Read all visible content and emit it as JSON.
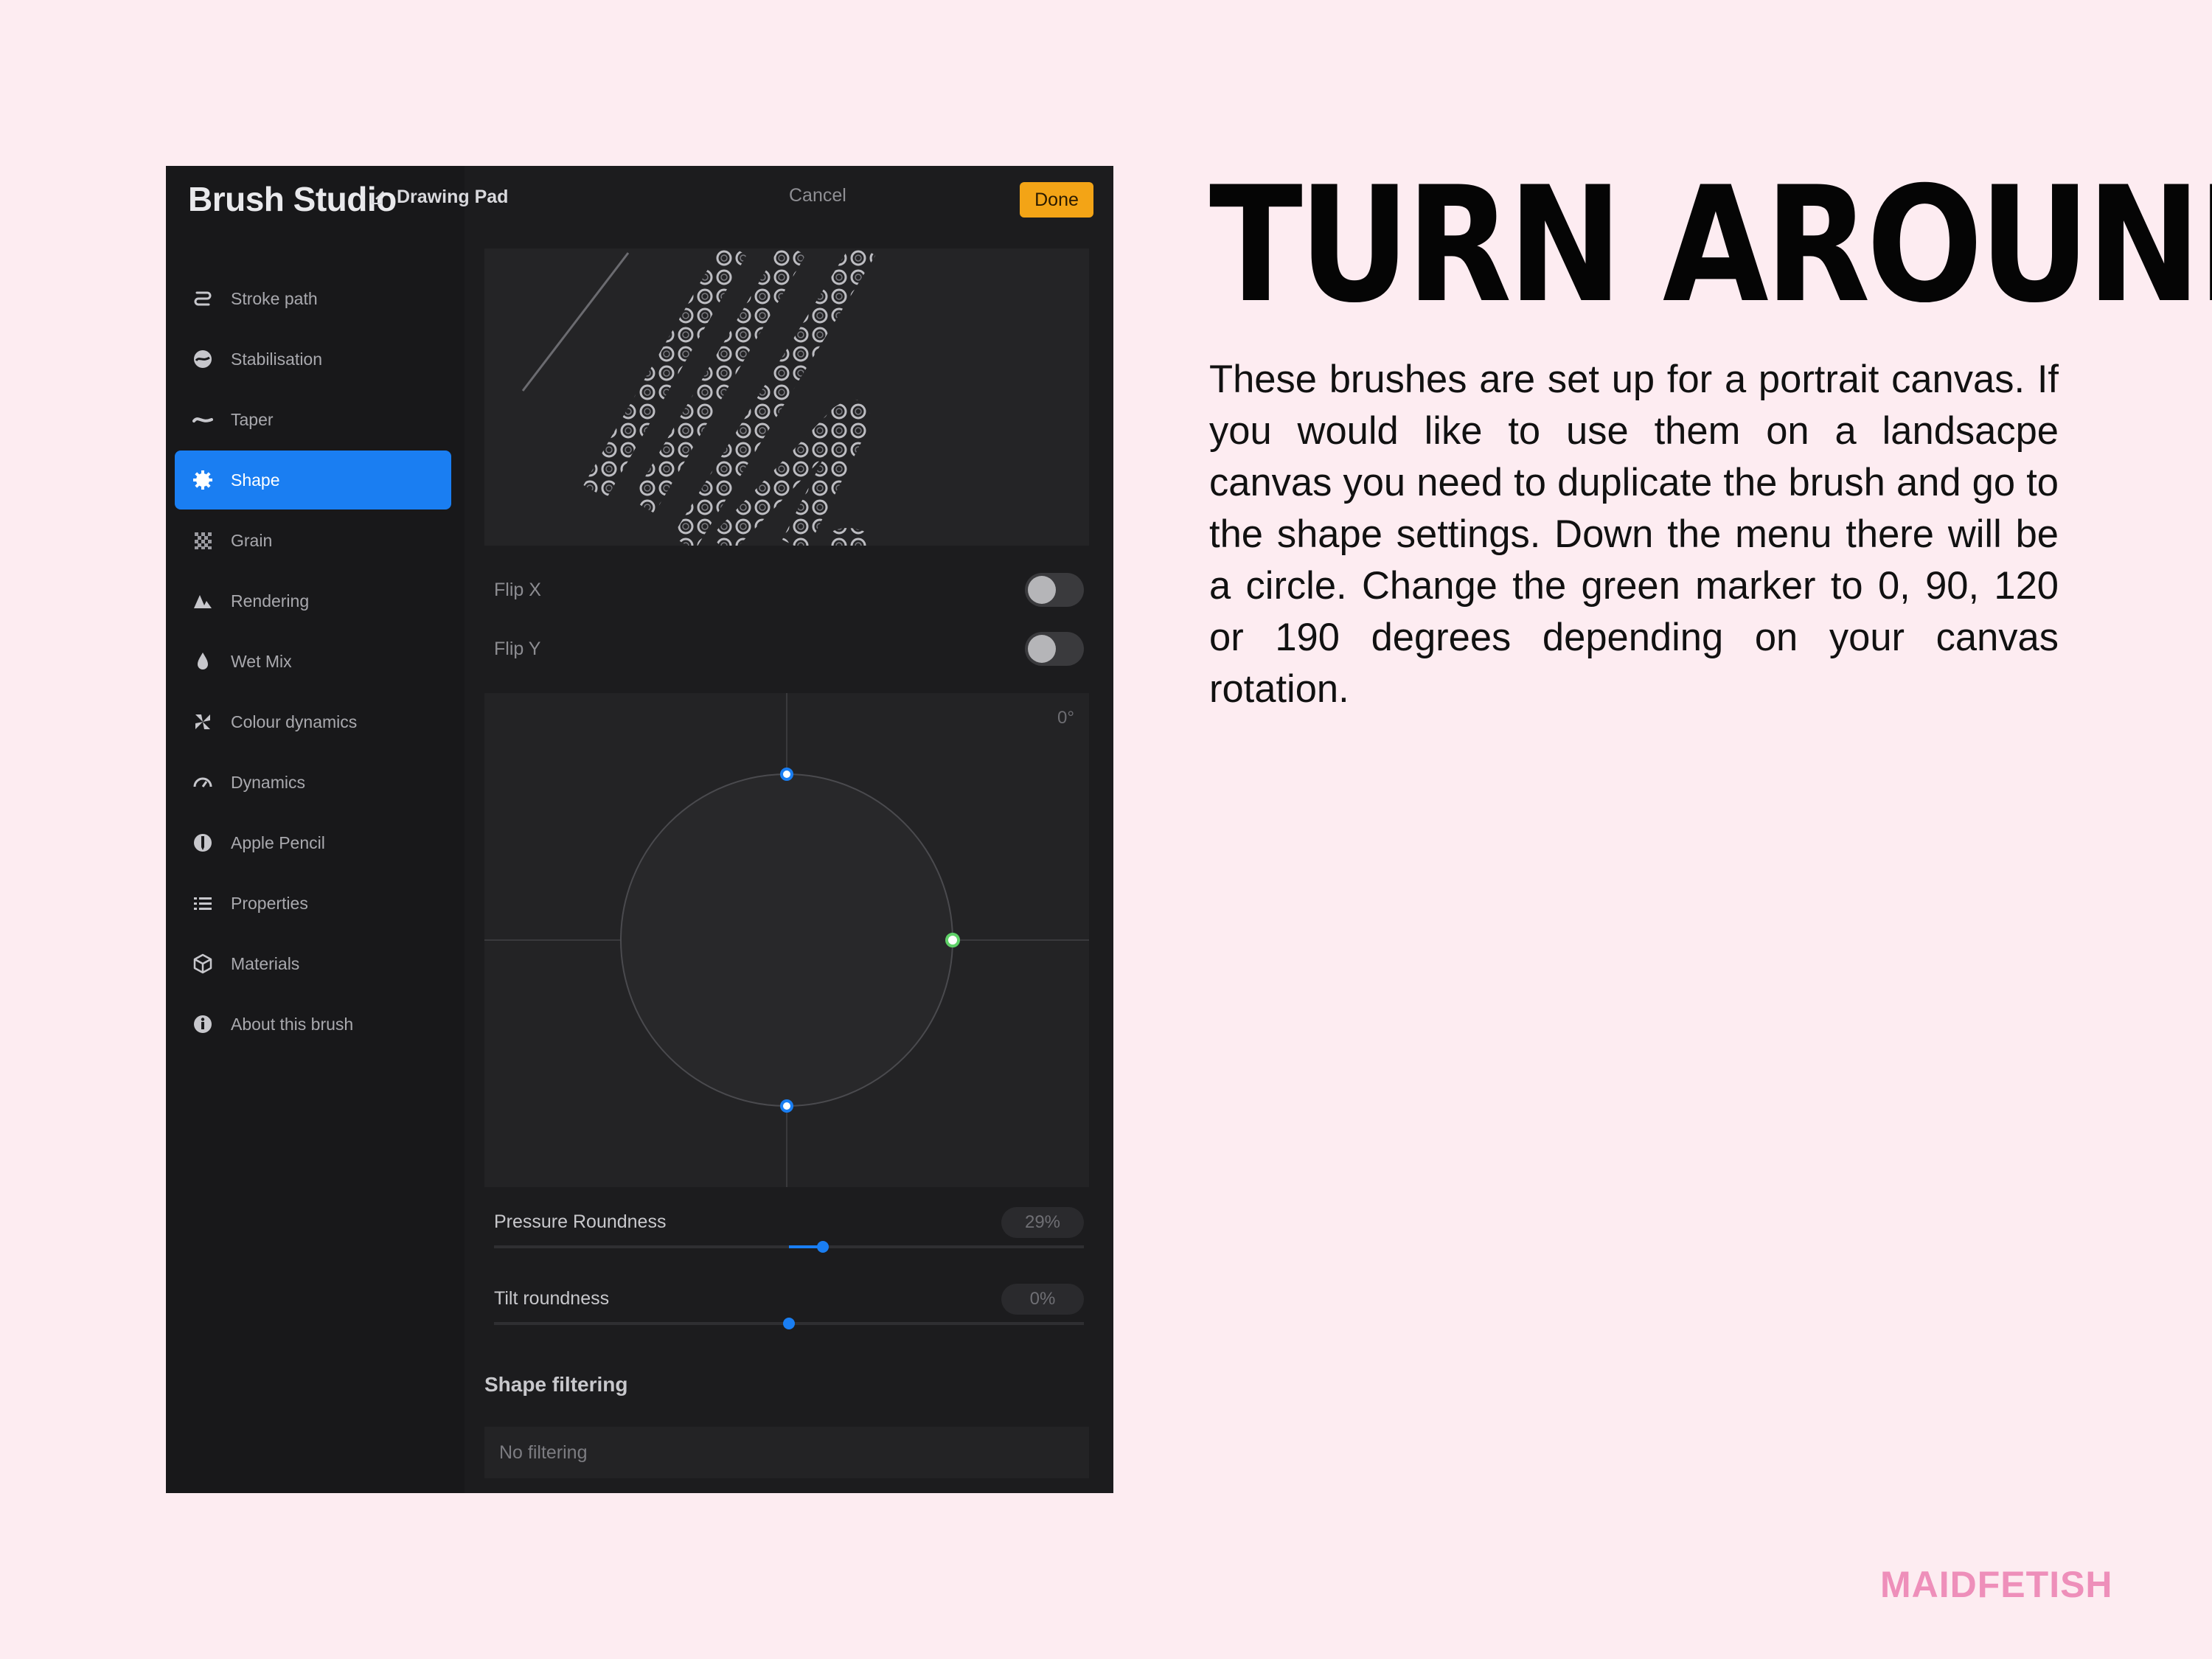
{
  "app": {
    "title": "Brush Studio",
    "drawing_pad_label": "Drawing Pad",
    "cancel_label": "Cancel",
    "done_label": "Done",
    "accent_color": "#1a7ef2",
    "done_color": "#f3a416"
  },
  "sidebar": {
    "items": [
      {
        "label": "Stroke path",
        "icon": "stroke-path-icon",
        "active": false
      },
      {
        "label": "Stabilisation",
        "icon": "stabilisation-icon",
        "active": false
      },
      {
        "label": "Taper",
        "icon": "taper-icon",
        "active": false
      },
      {
        "label": "Shape",
        "icon": "shape-gear-icon",
        "active": true
      },
      {
        "label": "Grain",
        "icon": "grain-icon",
        "active": false
      },
      {
        "label": "Rendering",
        "icon": "rendering-icon",
        "active": false
      },
      {
        "label": "Wet Mix",
        "icon": "wet-mix-drop-icon",
        "active": false
      },
      {
        "label": "Colour dynamics",
        "icon": "colour-dynamics-icon",
        "active": false
      },
      {
        "label": "Dynamics",
        "icon": "dynamics-gauge-icon",
        "active": false
      },
      {
        "label": "Apple Pencil",
        "icon": "apple-pencil-icon",
        "active": false
      },
      {
        "label": "Properties",
        "icon": "properties-list-icon",
        "active": false
      },
      {
        "label": "Materials",
        "icon": "materials-cube-icon",
        "active": false
      },
      {
        "label": "About this brush",
        "icon": "info-icon",
        "active": false
      }
    ]
  },
  "shape": {
    "flip_x_label": "Flip X",
    "flip_x_on": false,
    "flip_y_label": "Flip Y",
    "flip_y_on": false,
    "rotation_angle": "0°",
    "pressure_roundness_label": "Pressure Roundness",
    "pressure_roundness_value": "29%",
    "pressure_roundness_fraction": 0.29,
    "tilt_roundness_label": "Tilt roundness",
    "tilt_roundness_value": "0%",
    "tilt_roundness_fraction": 0,
    "filtering_section_title": "Shape filtering",
    "filtering_value": "No filtering"
  },
  "article": {
    "headline": "TURN AROUND",
    "body": "These brushes are set up for a portrait canvas. If you would like to use them on a landsacpe canvas you need to duplicate the brush and go to the shape settings. Down the menu there will be a circle. Change the green marker to 0, 90, 120 or 190 degrees depending on your canvas rotation.",
    "brand": "MAIDFETISH",
    "brand_color": "#ee8fba"
  }
}
